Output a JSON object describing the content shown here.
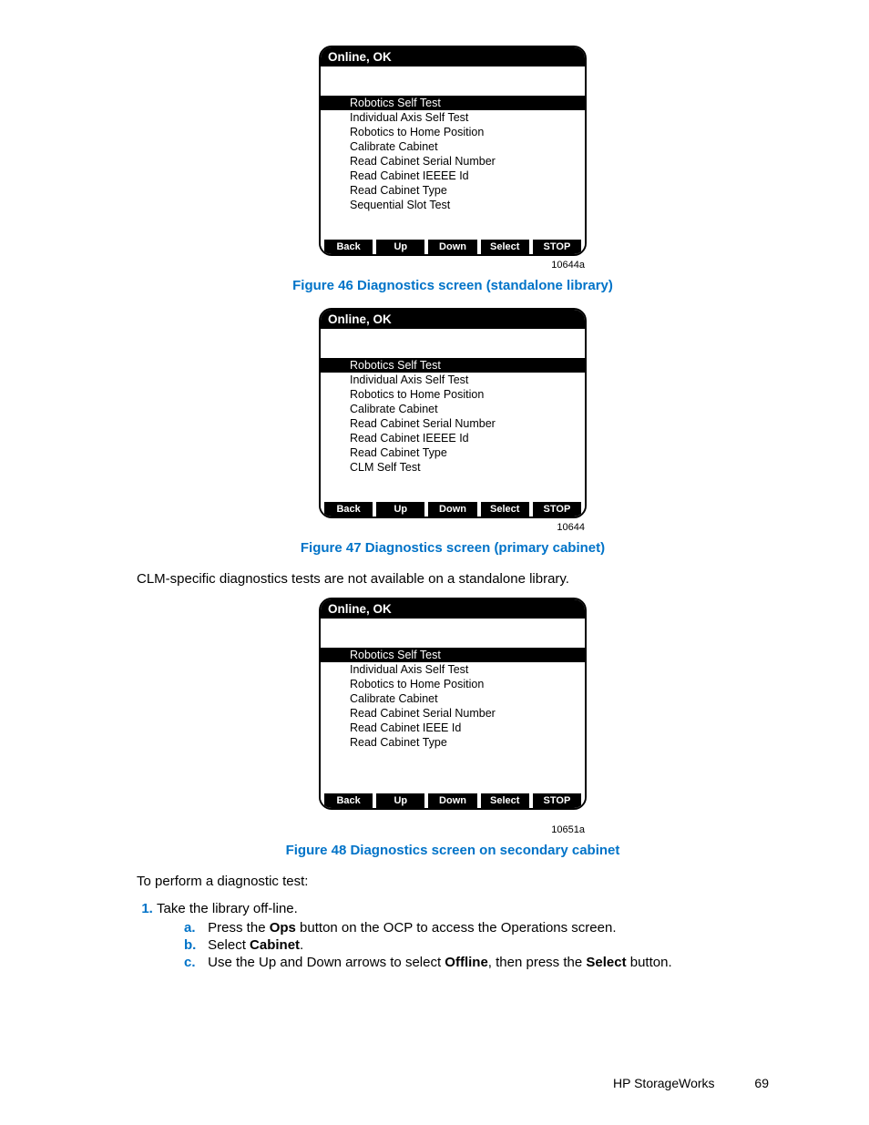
{
  "screens": [
    {
      "header": "Online, OK",
      "selected": "Robotics Self Test",
      "items": [
        "Individual Axis Self Test",
        "Robotics to Home Position",
        "Calibrate Cabinet",
        "Read Cabinet Serial Number",
        "Read Cabinet IEEEE Id",
        "Read Cabinet Type",
        "Sequential Slot Test"
      ],
      "buttons": [
        "Back",
        "Up",
        "Down",
        "Select",
        "STOP"
      ],
      "image_id": "10644a",
      "caption": "Figure 46 Diagnostics screen (standalone library)"
    },
    {
      "header": "Online, OK",
      "selected": "Robotics Self Test",
      "items": [
        "Individual Axis Self Test",
        "Robotics to Home Position",
        "Calibrate Cabinet",
        "Read Cabinet Serial Number",
        "Read Cabinet IEEEE Id",
        "Read Cabinet Type",
        "CLM Self Test"
      ],
      "buttons": [
        "Back",
        "Up",
        "Down",
        "Select",
        "STOP"
      ],
      "image_id": "10644",
      "caption": "Figure 47 Diagnostics screen (primary cabinet)"
    },
    {
      "header": "Online, OK",
      "selected": "Robotics Self Test",
      "items": [
        "Individual Axis Self Test",
        "Robotics to Home Position",
        "Calibrate Cabinet",
        "Read Cabinet Serial Number",
        "Read Cabinet IEEE Id",
        "Read Cabinet Type"
      ],
      "buttons": [
        "Back",
        "Up",
        "Down",
        "Select",
        "STOP"
      ],
      "image_id": "10651a",
      "caption": "Figure 48 Diagnostics screen on secondary cabinet"
    }
  ],
  "text": {
    "clm_note": "CLM-specific diagnostics tests are not available on a standalone library.",
    "perform_intro": "To perform a diagnostic test:",
    "step1": "Take the library off-line.",
    "step_a_pre": "Press the ",
    "step_a_bold": "Ops",
    "step_a_post": " button on the OCP to access the Operations screen.",
    "step_b_pre": "Select ",
    "step_b_bold": "Cabinet",
    "step_b_post": ".",
    "step_c_pre": "Use the Up and Down arrows to select ",
    "step_c_bold1": "Offline",
    "step_c_mid": ", then press the ",
    "step_c_bold2": "Select",
    "step_c_post": " button."
  },
  "footer": {
    "label": "HP StorageWorks",
    "page": "69"
  }
}
